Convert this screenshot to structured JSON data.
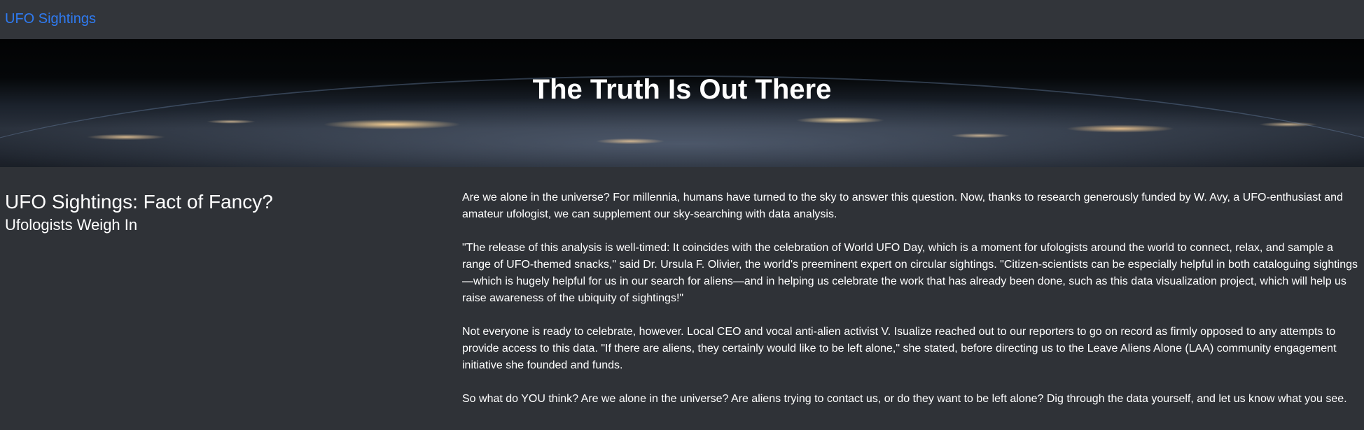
{
  "navbar": {
    "brand": "UFO Sightings"
  },
  "hero": {
    "title": "The Truth Is Out There"
  },
  "article": {
    "headline": "UFO Sightings: Fact of Fancy?",
    "subhead": "Ufologists Weigh In",
    "paragraphs": [
      "Are we alone in the universe? For millennia, humans have turned to the sky to answer this question. Now, thanks to research generously funded by W. Avy, a UFO-enthusiast and amateur ufologist, we can supplement our sky-searching with data analysis.",
      "\"The release of this analysis is well-timed: It coincides with the celebration of World UFO Day, which is a moment for ufologists around the world to connect, relax, and sample a range of UFO-themed snacks,\" said Dr. Ursula F. Olivier, the world's preeminent expert on circular sightings. \"Citizen-scientists can be especially helpful in both cataloguing sightings—which is hugely helpful for us in our search for aliens—and in helping us celebrate the work that has already been done, such as this data visualization project, which will help us raise awareness of the ubiquity of sightings!\"",
      "Not everyone is ready to celebrate, however. Local CEO and vocal anti-alien activist V. Isualize reached out to our reporters to go on record as firmly opposed to any attempts to provide access to this data. \"If there are aliens, they certainly would like to be left alone,\" she stated, before directing us to the Leave Aliens Alone (LAA) community engagement initiative she founded and funds.",
      "So what do YOU think? Are we alone in the universe? Are aliens trying to contact us, or do they want to be left alone? Dig through the data yourself, and let us know what you see."
    ]
  }
}
